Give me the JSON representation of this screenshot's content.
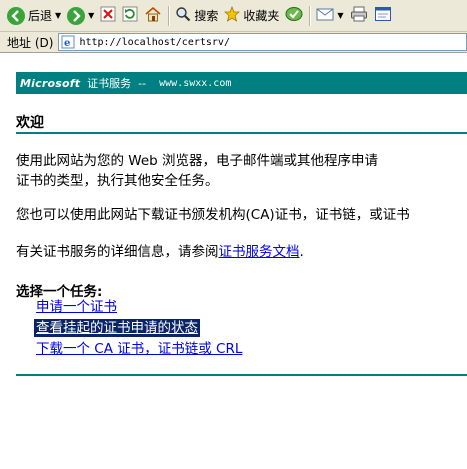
{
  "toolbar": {
    "back_label": "后退",
    "search_label": "搜索",
    "favorites_label": "收藏夹"
  },
  "address": {
    "label": "地址",
    "accesskey": "(D)",
    "url": "http://localhost/certsrv/"
  },
  "banner": {
    "brand": "Microsoft",
    "service": "证书服务",
    "separator": "--",
    "host": "www.swxx.com"
  },
  "main": {
    "heading": "欢迎",
    "para1_line1": "使用此网站为您的 Web 浏览器，电子邮件端或其他程序申请",
    "para1_line2": "证书的类型，执行其他安全任务。",
    "para2": "您也可以使用此网站下载证书颁发机构(CA)证书，证书链，或证书",
    "para3_prefix": "有关证书服务的详细信息，请参阅",
    "para3_link": "证书服务文档",
    "para3_suffix": ".",
    "tasks_title": "选择一个任务:",
    "tasks": [
      "申请一个证书",
      "查看挂起的证书申请的状态",
      "下载一个 CA 证书，证书链或 CRL"
    ]
  },
  "colors": {
    "teal": "#008080",
    "link": "#0000ee",
    "selection": "#0a246a",
    "chrome": "#ece9d8"
  }
}
